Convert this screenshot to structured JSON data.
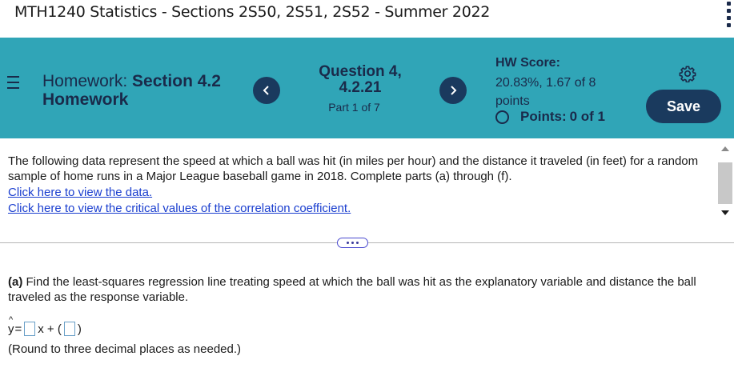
{
  "course": {
    "title": "MTH1240 Statistics - Sections 2S50, 2S51, 2S52 - Summer 2022"
  },
  "header": {
    "homework_prefix": "Homework:",
    "homework_name_line1": "Section 4.2",
    "homework_name_line2": "Homework",
    "question_line1": "Question 4,",
    "question_line2": "4.2.21",
    "part": "Part 1 of 7",
    "prev_symbol": "<",
    "next_symbol": ">",
    "score_label": "HW Score:",
    "score_value": "20.83%, 1.67 of 8 points",
    "points_label": "Points:",
    "points_value": "0 of 1",
    "save_label": "Save"
  },
  "question": {
    "text": "The following data represent the speed at which a ball was hit (in miles per hour) and the distance it traveled (in feet) for a random sample of home runs in a Major League baseball game in 2018. Complete parts (a) through (f).",
    "link_data": "Click here to view the data.",
    "link_critical": "Click here to view the critical values of the correlation coefficient."
  },
  "part_a": {
    "label": "(a)",
    "text": "Find the least-squares regression line treating speed at which the ball was hit as the explanatory variable and distance the ball traveled as the response variable.",
    "eq_y": "y",
    "eq_hat": "^",
    "eq_equals": "=",
    "eq_x_plus": "x + (",
    "eq_close": ")",
    "slope_value": "",
    "intercept_value": "",
    "note": "(Round to three decimal places as needed.)"
  },
  "icons": {
    "menu": "menu-icon",
    "gear": "gear-icon",
    "prev": "chevron-left-icon",
    "next": "chevron-right-icon",
    "kebab": "more-vertical-icon"
  },
  "colors": {
    "header_band": "#30a5b7",
    "button_dark": "#1a3a5e",
    "link": "#1a3ecf",
    "text_dark": "#1a2a4a"
  }
}
